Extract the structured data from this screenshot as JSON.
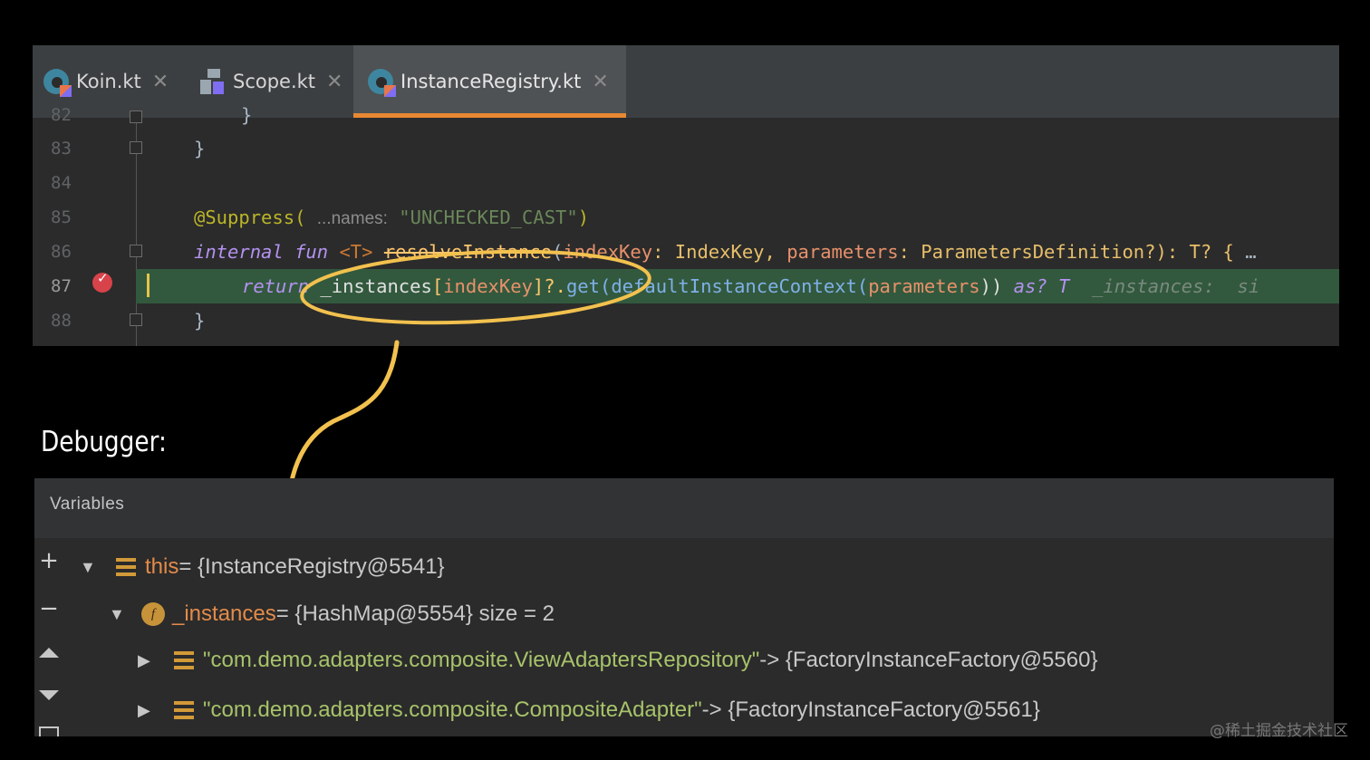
{
  "tabs": [
    {
      "label": "Koin.kt",
      "icon": "kotlin-file-icon",
      "active": false
    },
    {
      "label": "Scope.kt",
      "icon": "kotlin-class-icon",
      "active": false
    },
    {
      "label": "InstanceRegistry.kt",
      "icon": "kotlin-file-icon",
      "active": true
    }
  ],
  "close_glyph": "✕",
  "code": {
    "line_numbers": [
      "82",
      "83",
      "84",
      "85",
      "86",
      "87",
      "88"
    ],
    "l82": "}",
    "l83": "}",
    "l85_ann": "@Suppress(",
    "l85_hint": "...names:",
    "l85_str": "\"UNCHECKED_CAST\"",
    "l85_close": ")",
    "l86_internal": "internal",
    "l86_fun": "fun",
    "l86_generic": "<T>",
    "l86_name": "resolveInstance",
    "l86_open": "(",
    "l86_p1": "indexKey",
    "l86_t1": ": IndexKey, ",
    "l86_p2": "parameters",
    "l86_t2": ": ParametersDefinition?): T? {",
    "l86_tail": " …",
    "l87_return": "return",
    "l87_field": "_instances",
    "l87_open": "[",
    "l87_index": "indexKey",
    "l87_mid": "]?.",
    "l87_get": "get",
    "l87_call": "(defaultInstanceContext(",
    "l87_param": "parameters",
    "l87_close": ")) ",
    "l87_as": "as? T",
    "l87_inlay": "  _instances:  si",
    "l88": "}"
  },
  "debugger_heading": "Debugger:",
  "variables": {
    "title": "Variables",
    "rows": [
      {
        "name": "this",
        "value": " = {InstanceRegistry@5541}"
      },
      {
        "name": "_instances",
        "value": " = {HashMap@5554}  size = 2"
      },
      {
        "key": "\"com.demo.adapters.composite.ViewAdaptersRepository\"",
        "value": " -> {FactoryInstanceFactory@5560}"
      },
      {
        "key": "\"com.demo.adapters.composite.CompositeAdapter\"",
        "value": " -> {FactoryInstanceFactory@5561}"
      }
    ]
  },
  "watermark": "@稀土掘金技术社区",
  "colors": {
    "accent_underline": "#e88833",
    "annotation_yellow": "#f2c14e",
    "current_line": "#32593d"
  }
}
